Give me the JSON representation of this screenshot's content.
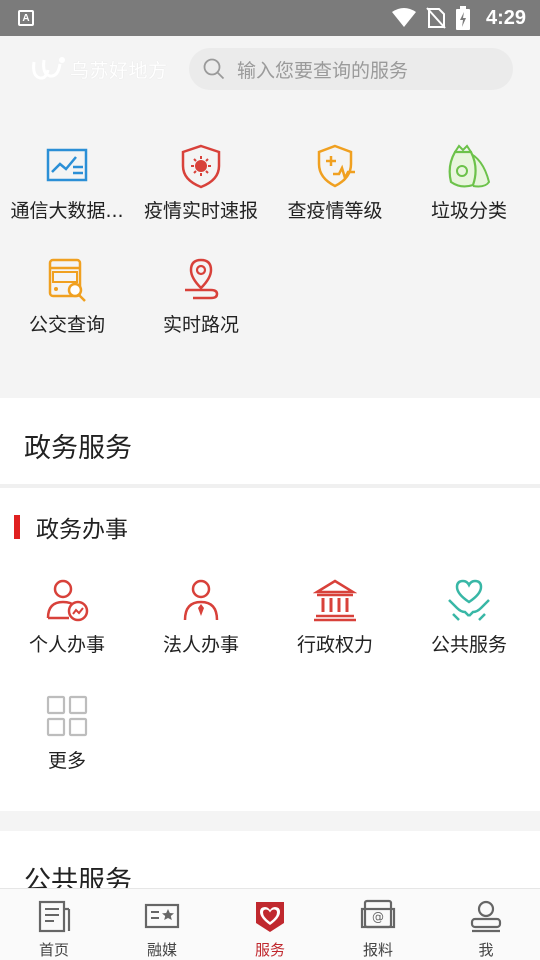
{
  "status_bar": {
    "time": "4:29",
    "badge": "A"
  },
  "header": {
    "logo_text": "乌苏好地方",
    "search_placeholder": "输入您要查询的服务"
  },
  "quick_items": [
    {
      "label": "通信大数据...",
      "icon": "data-chart-icon"
    },
    {
      "label": "疫情实时速报",
      "icon": "virus-shield-icon"
    },
    {
      "label": "查疫情等级",
      "icon": "health-shield-icon"
    },
    {
      "label": "垃圾分类",
      "icon": "garbage-bag-icon"
    },
    {
      "label": "公交查询",
      "icon": "bus-search-icon"
    },
    {
      "label": "实时路况",
      "icon": "location-route-icon"
    }
  ],
  "government_section": {
    "title": "政务服务",
    "subtitle": "政务办事",
    "items": [
      {
        "label": "个人办事",
        "icon": "person-service-icon"
      },
      {
        "label": "法人办事",
        "icon": "legal-person-icon"
      },
      {
        "label": "行政权力",
        "icon": "government-building-icon"
      },
      {
        "label": "公共服务",
        "icon": "heart-hands-icon"
      },
      {
        "label": "更多",
        "icon": "grid-more-icon"
      }
    ]
  },
  "public_section": {
    "title": "公共服务"
  },
  "bottom_nav": [
    {
      "label": "首页",
      "icon": "home-news-icon",
      "active": false
    },
    {
      "label": "融媒",
      "icon": "media-card-icon",
      "active": false
    },
    {
      "label": "服务",
      "icon": "service-heart-icon",
      "active": true
    },
    {
      "label": "报料",
      "icon": "report-icon",
      "active": false
    },
    {
      "label": "我",
      "icon": "profile-icon",
      "active": false
    }
  ],
  "colors": {
    "accent_red": "#c0282e",
    "blue": "#2b8fd6",
    "orange": "#f0a020",
    "green": "#6cc24a",
    "teal": "#38b7a6",
    "red_icon": "#d8413a"
  }
}
